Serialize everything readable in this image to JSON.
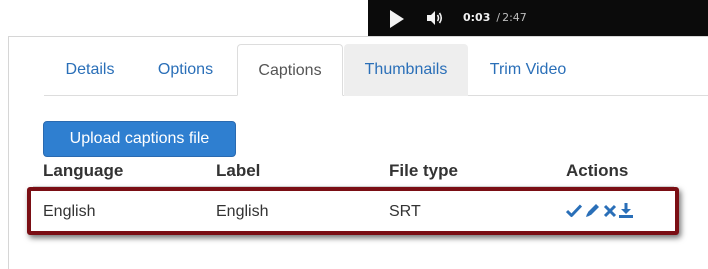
{
  "player": {
    "current_time": "0:03",
    "separator": "/",
    "duration": "2:47",
    "play_icon": "play-icon",
    "volume_icon": "volume-icon"
  },
  "tabs": [
    {
      "label": "Details",
      "active": false
    },
    {
      "label": "Options",
      "active": false
    },
    {
      "label": "Captions",
      "active": true
    },
    {
      "label": "Thumbnails",
      "active": false
    },
    {
      "label": "Trim Video",
      "active": false
    }
  ],
  "upload_button": {
    "label": "Upload captions file"
  },
  "captions_table": {
    "columns": [
      "Language",
      "Label",
      "File type",
      "Actions"
    ],
    "rows": [
      {
        "language": "English",
        "label": "English",
        "file_type": "SRT",
        "actions": [
          "check-icon",
          "pencil-icon",
          "delete-icon",
          "download-icon"
        ]
      }
    ]
  },
  "colors": {
    "link_blue": "#2a6fb8",
    "button_blue": "#2f7fd0",
    "highlight_border": "#7a0e14",
    "player_bg": "#0b0b0b"
  }
}
